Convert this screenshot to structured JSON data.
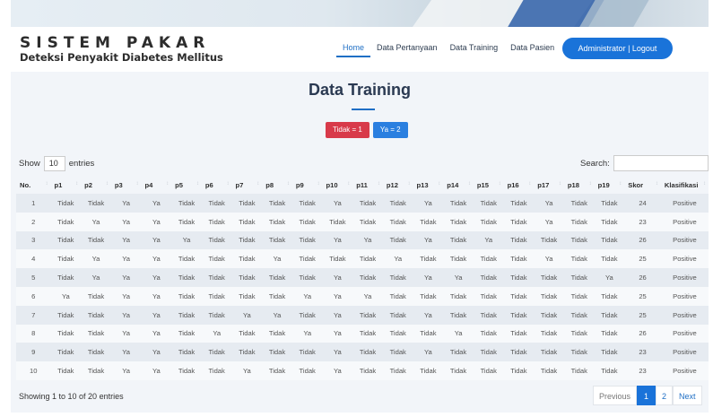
{
  "header": {
    "title": "SISTEM PAKAR",
    "subtitle": "Deteksi Penyakit Diabetes Mellitus"
  },
  "nav": [
    {
      "label": "Home",
      "active": true
    },
    {
      "label": "Data Pertanyaan",
      "active": false
    },
    {
      "label": "Data Training",
      "active": false
    },
    {
      "label": "Data Pasien",
      "active": false
    }
  ],
  "admin_button": "Administrator | Logout",
  "page_title": "Data Training",
  "legend": {
    "tidak": "Tidak = 1",
    "ya": "Ya = 2"
  },
  "controls": {
    "show_label": "Show",
    "show_value": "10",
    "entries_label": "entries",
    "search_label": "Search:"
  },
  "table": {
    "headers": [
      "No.",
      "p1",
      "p2",
      "p3",
      "p4",
      "p5",
      "p6",
      "p7",
      "p8",
      "p9",
      "p10",
      "p11",
      "p12",
      "p13",
      "p14",
      "p15",
      "p16",
      "p17",
      "p18",
      "p19",
      "Skor",
      "Klasifikasi"
    ],
    "rows": [
      [
        "1",
        "Tidak",
        "Tidak",
        "Ya",
        "Ya",
        "Tidak",
        "Tidak",
        "Tidak",
        "Tidak",
        "Tidak",
        "Ya",
        "Tidak",
        "Tidak",
        "Ya",
        "Tidak",
        "Tidak",
        "Tidak",
        "Ya",
        "Tidak",
        "Tidak",
        "24",
        "Positive"
      ],
      [
        "2",
        "Tidak",
        "Ya",
        "Ya",
        "Ya",
        "Tidak",
        "Tidak",
        "Tidak",
        "Tidak",
        "Tidak",
        "Tidak",
        "Tidak",
        "Tidak",
        "Tidak",
        "Tidak",
        "Tidak",
        "Tidak",
        "Ya",
        "Tidak",
        "Tidak",
        "23",
        "Positive"
      ],
      [
        "3",
        "Tidak",
        "Tidak",
        "Ya",
        "Ya",
        "Ya",
        "Tidak",
        "Tidak",
        "Tidak",
        "Tidak",
        "Ya",
        "Ya",
        "Tidak",
        "Ya",
        "Tidak",
        "Ya",
        "Tidak",
        "Tidak",
        "Tidak",
        "Tidak",
        "26",
        "Positive"
      ],
      [
        "4",
        "Tidak",
        "Ya",
        "Ya",
        "Ya",
        "Tidak",
        "Tidak",
        "Tidak",
        "Ya",
        "Tidak",
        "Tidak",
        "Tidak",
        "Ya",
        "Tidak",
        "Tidak",
        "Tidak",
        "Tidak",
        "Ya",
        "Tidak",
        "Tidak",
        "25",
        "Positive"
      ],
      [
        "5",
        "Tidak",
        "Ya",
        "Ya",
        "Ya",
        "Tidak",
        "Tidak",
        "Tidak",
        "Tidak",
        "Tidak",
        "Ya",
        "Tidak",
        "Tidak",
        "Ya",
        "Ya",
        "Tidak",
        "Tidak",
        "Tidak",
        "Tidak",
        "Ya",
        "26",
        "Positive"
      ],
      [
        "6",
        "Ya",
        "Tidak",
        "Ya",
        "Ya",
        "Tidak",
        "Tidak",
        "Tidak",
        "Tidak",
        "Ya",
        "Ya",
        "Ya",
        "Tidak",
        "Tidak",
        "Tidak",
        "Tidak",
        "Tidak",
        "Tidak",
        "Tidak",
        "Tidak",
        "25",
        "Positive"
      ],
      [
        "7",
        "Tidak",
        "Tidak",
        "Ya",
        "Ya",
        "Tidak",
        "Tidak",
        "Ya",
        "Ya",
        "Tidak",
        "Ya",
        "Tidak",
        "Tidak",
        "Ya",
        "Tidak",
        "Tidak",
        "Tidak",
        "Tidak",
        "Tidak",
        "Tidak",
        "25",
        "Positive"
      ],
      [
        "8",
        "Tidak",
        "Tidak",
        "Ya",
        "Ya",
        "Tidak",
        "Ya",
        "Tidak",
        "Tidak",
        "Ya",
        "Ya",
        "Tidak",
        "Tidak",
        "Tidak",
        "Ya",
        "Tidak",
        "Tidak",
        "Tidak",
        "Tidak",
        "Tidak",
        "26",
        "Positive"
      ],
      [
        "9",
        "Tidak",
        "Tidak",
        "Ya",
        "Ya",
        "Tidak",
        "Tidak",
        "Tidak",
        "Tidak",
        "Tidak",
        "Ya",
        "Tidak",
        "Tidak",
        "Ya",
        "Tidak",
        "Tidak",
        "Tidak",
        "Tidak",
        "Tidak",
        "Tidak",
        "23",
        "Positive"
      ],
      [
        "10",
        "Tidak",
        "Tidak",
        "Ya",
        "Ya",
        "Tidak",
        "Tidak",
        "Ya",
        "Tidak",
        "Tidak",
        "Ya",
        "Tidak",
        "Tidak",
        "Tidak",
        "Tidak",
        "Tidak",
        "Tidak",
        "Tidak",
        "Tidak",
        "Tidak",
        "23",
        "Positive"
      ]
    ]
  },
  "footer": {
    "info": "Showing 1 to 10 of 20 entries",
    "prev": "Previous",
    "pages": [
      "1",
      "2"
    ],
    "next": "Next"
  },
  "colors": {
    "accent": "#1a73d9",
    "badge_red": "#d83a4a",
    "badge_blue": "#2a7fe0"
  }
}
